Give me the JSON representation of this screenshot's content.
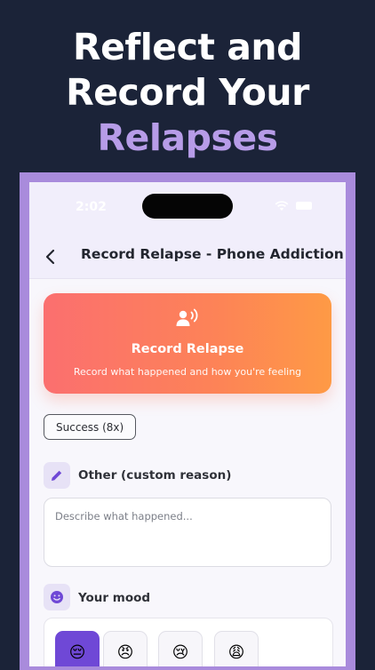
{
  "promo": {
    "line1": "Reflect and",
    "line2": "Record Your",
    "line3": "Relapses",
    "accent_color": "#b79ce8"
  },
  "statusbar": {
    "time": "2:02",
    "icons": [
      "wifi-icon",
      "battery-icon"
    ]
  },
  "navbar": {
    "back_icon": "chevron-left-icon",
    "title": "Record Relapse - Phone Addiction"
  },
  "hero": {
    "icon": "voice-record-icon",
    "title": "Record Relapse",
    "subtitle": "Record what happened and how you're feeling",
    "gradient_colors": [
      "#fb6f6f",
      "#fe9a45"
    ]
  },
  "success_chip": "Success (8x)",
  "reason_section": {
    "icon": "pencil-icon",
    "label": "Other (custom reason)",
    "placeholder": "Describe what happened...",
    "value": ""
  },
  "mood_section": {
    "icon": "smiley-icon",
    "label": "Your mood",
    "options": [
      {
        "emoji": "😔",
        "selected": true
      },
      {
        "emoji": "😠",
        "selected": false
      },
      {
        "emoji": "😢",
        "selected": false
      },
      {
        "emoji": "😩",
        "selected": false
      }
    ],
    "selected_color": "#6f48d6"
  }
}
